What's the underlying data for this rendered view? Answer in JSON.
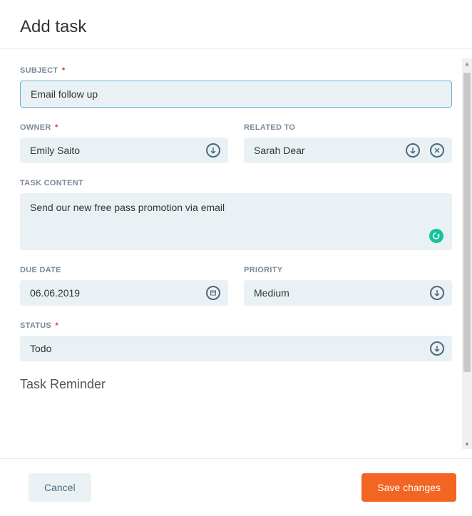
{
  "header": {
    "title": "Add task"
  },
  "labels": {
    "subject": "SUBJECT",
    "owner": "OWNER",
    "related_to": "RELATED TO",
    "task_content": "TASK CONTENT",
    "due_date": "DUE DATE",
    "priority": "PRIORITY",
    "status": "STATUS"
  },
  "values": {
    "subject": "Email follow up",
    "owner": "Emily Saito",
    "related_to": "Sarah Dear",
    "task_content": "Send our new free pass promotion via email",
    "due_date": "06.06.2019",
    "priority": "Medium",
    "status": "Todo"
  },
  "section": {
    "reminder_title": "Task Reminder"
  },
  "footer": {
    "cancel": "Cancel",
    "save": "Save changes"
  },
  "required_marker": "*"
}
